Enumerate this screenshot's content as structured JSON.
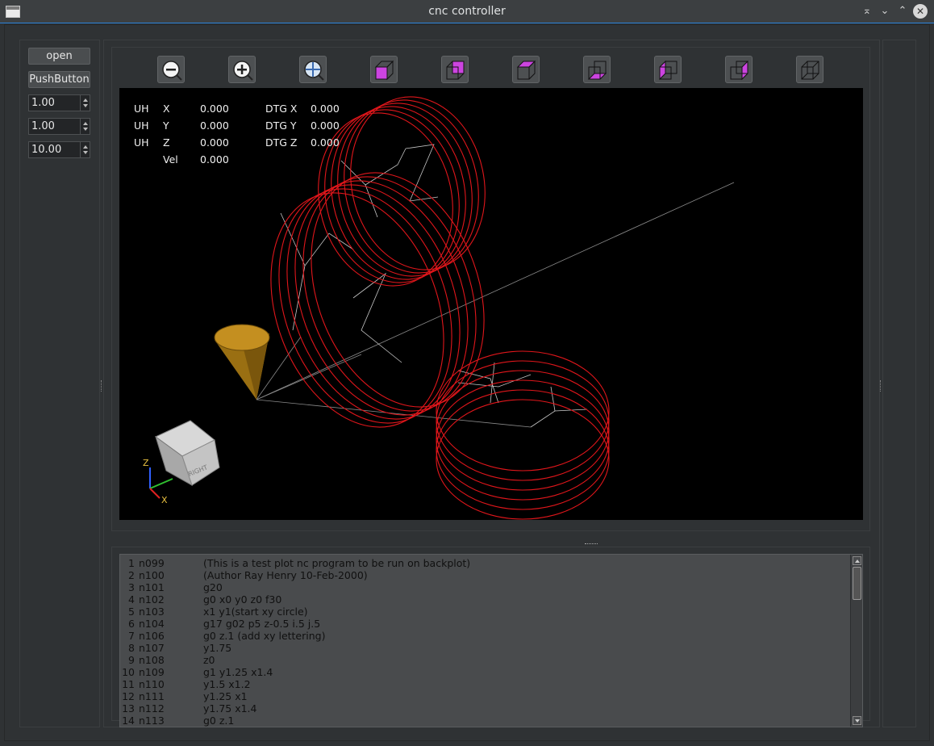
{
  "window": {
    "title": "cnc controller"
  },
  "left_panel": {
    "open_label": "open",
    "push_label": "PushButton",
    "spin1": "1.00",
    "spin2": "1.00",
    "spin3": "10.00"
  },
  "toolbar": {
    "buttons": [
      "zoom-out",
      "zoom-in",
      "zoom-fit",
      "view-iso",
      "view-top",
      "view-front",
      "view-bottom",
      "view-left",
      "view-right",
      "view-back"
    ]
  },
  "dro": {
    "rows": [
      {
        "unit": "UH",
        "axis": "X",
        "value": "0.000",
        "dtg_label": "DTG X",
        "dtg_value": "0.000"
      },
      {
        "unit": "UH",
        "axis": "Y",
        "value": "0.000",
        "dtg_label": "DTG Y",
        "dtg_value": "0.000"
      },
      {
        "unit": "UH",
        "axis": "Z",
        "value": "0.000",
        "dtg_label": "DTG Z",
        "dtg_value": "0.000"
      }
    ],
    "vel_label": "Vel",
    "vel_value": "0.000"
  },
  "view_cube": {
    "face_label": "RIGHT",
    "axis_z": "Z",
    "axis_x": "X"
  },
  "gcode": {
    "lines": [
      {
        "n": "1",
        "label": "n099",
        "code": "(This is a test plot nc program to be run on backplot)"
      },
      {
        "n": "2",
        "label": "n100",
        "code": "(Author Ray Henry 10-Feb-2000)"
      },
      {
        "n": "3",
        "label": "n101",
        "code": "g20"
      },
      {
        "n": "4",
        "label": "n102",
        "code": "g0 x0 y0 z0 f30"
      },
      {
        "n": "5",
        "label": "n103",
        "code": "x1 y1(start xy circle)"
      },
      {
        "n": "6",
        "label": "n104",
        "code": "g17 g02 p5 z-0.5 i.5 j.5"
      },
      {
        "n": "7",
        "label": "n106",
        "code": "g0 z.1 (add xy lettering)"
      },
      {
        "n": "8",
        "label": "n107",
        "code": "y1.75"
      },
      {
        "n": "9",
        "label": "n108",
        "code": "z0"
      },
      {
        "n": "10",
        "label": "n109",
        "code": "g1 y1.25 x1.4"
      },
      {
        "n": "11",
        "label": "n110",
        "code": "y1.5 x1.2"
      },
      {
        "n": "12",
        "label": "n111",
        "code": "y1.25 x1"
      },
      {
        "n": "13",
        "label": "n112",
        "code": "y1.75 x1.4"
      },
      {
        "n": "14",
        "label": "n113",
        "code": "g0 z.1"
      }
    ]
  },
  "colors": {
    "toolpath": "#e0161b",
    "rapid": "#c8c8c8",
    "tool": "#b8860b",
    "background": "#000000",
    "view_face": "#cc44e0"
  }
}
